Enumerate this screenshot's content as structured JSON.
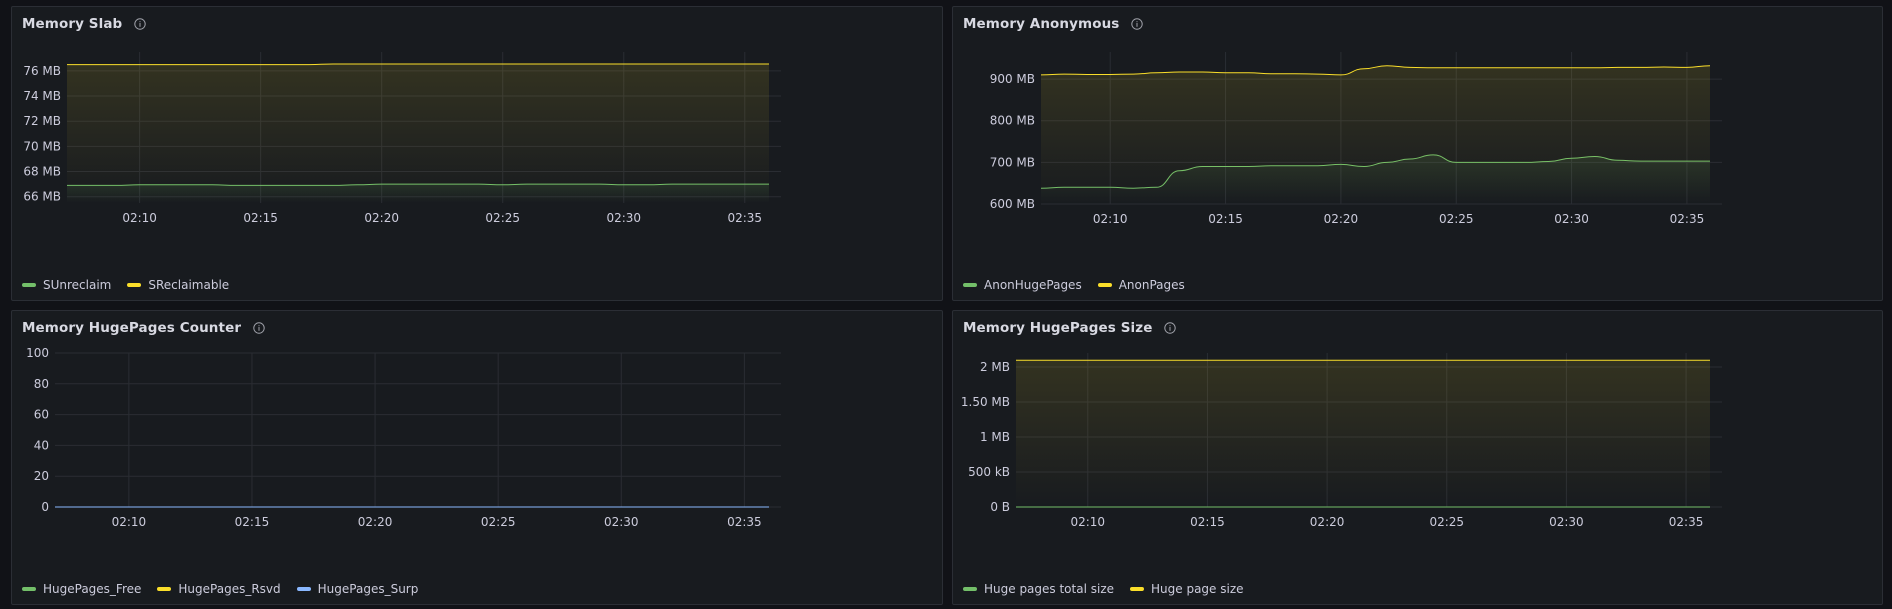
{
  "colors": {
    "green": "#73bf69",
    "yellow": "#fade2a",
    "blue": "#8ab8ff",
    "grid": "#2a2d33",
    "text": "#ccccdc"
  },
  "panels": [
    {
      "title": "Memory Slab",
      "info_icon": "info-icon",
      "legend": [
        {
          "label": "SUnreclaim",
          "color": "#73bf69"
        },
        {
          "label": "SReclaimable",
          "color": "#fade2a"
        }
      ]
    },
    {
      "title": "Memory Anonymous",
      "info_icon": "info-icon",
      "legend": [
        {
          "label": "AnonHugePages",
          "color": "#73bf69"
        },
        {
          "label": "AnonPages",
          "color": "#fade2a"
        }
      ]
    },
    {
      "title": "Memory HugePages Counter",
      "info_icon": "info-icon",
      "legend": [
        {
          "label": "HugePages_Free",
          "color": "#73bf69"
        },
        {
          "label": "HugePages_Rsvd",
          "color": "#fade2a"
        },
        {
          "label": "HugePages_Surp",
          "color": "#8ab8ff"
        }
      ]
    },
    {
      "title": "Memory HugePages Size",
      "info_icon": "info-icon",
      "legend": [
        {
          "label": "Huge pages total size",
          "color": "#73bf69"
        },
        {
          "label": "Huge page size",
          "color": "#fade2a"
        }
      ]
    }
  ],
  "chart_data": [
    {
      "type": "line",
      "title": "Memory Slab",
      "x": [
        "02:07",
        "02:08",
        "02:09",
        "02:10",
        "02:11",
        "02:12",
        "02:13",
        "02:14",
        "02:15",
        "02:16",
        "02:17",
        "02:18",
        "02:19",
        "02:20",
        "02:21",
        "02:22",
        "02:23",
        "02:24",
        "02:25",
        "02:26",
        "02:27",
        "02:28",
        "02:29",
        "02:30",
        "02:31",
        "02:32",
        "02:33",
        "02:34",
        "02:35",
        "02:36"
      ],
      "xticks": [
        "02:10",
        "02:15",
        "02:20",
        "02:25",
        "02:30",
        "02:35"
      ],
      "yticks": [
        "66 MB",
        "68 MB",
        "70 MB",
        "72 MB",
        "74 MB",
        "76 MB"
      ],
      "ylim": [
        65.5,
        77.5
      ],
      "series": [
        {
          "name": "SUnreclaim",
          "color": "#73bf69",
          "values": [
            66.9,
            66.9,
            66.9,
            66.95,
            66.95,
            66.95,
            66.95,
            66.9,
            66.9,
            66.9,
            66.9,
            66.9,
            66.95,
            67.0,
            67.0,
            67.0,
            67.0,
            67.0,
            66.95,
            67.0,
            67.0,
            67.0,
            67.0,
            66.95,
            66.95,
            67.0,
            67.0,
            67.0,
            67.0,
            67.0
          ]
        },
        {
          "name": "SReclaimable",
          "color": "#fade2a",
          "values": [
            76.5,
            76.5,
            76.5,
            76.5,
            76.5,
            76.5,
            76.5,
            76.5,
            76.5,
            76.5,
            76.5,
            76.55,
            76.55,
            76.55,
            76.55,
            76.55,
            76.55,
            76.55,
            76.55,
            76.55,
            76.55,
            76.55,
            76.55,
            76.55,
            76.55,
            76.55,
            76.55,
            76.55,
            76.55,
            76.55
          ]
        }
      ]
    },
    {
      "type": "line",
      "title": "Memory Anonymous",
      "x": [
        "02:07",
        "02:08",
        "02:09",
        "02:10",
        "02:11",
        "02:12",
        "02:13",
        "02:14",
        "02:15",
        "02:16",
        "02:17",
        "02:18",
        "02:19",
        "02:20",
        "02:21",
        "02:22",
        "02:23",
        "02:24",
        "02:25",
        "02:26",
        "02:27",
        "02:28",
        "02:29",
        "02:30",
        "02:31",
        "02:32",
        "02:33",
        "02:34",
        "02:35",
        "02:36"
      ],
      "xticks": [
        "02:10",
        "02:15",
        "02:20",
        "02:25",
        "02:30",
        "02:35"
      ],
      "yticks": [
        "600 MB",
        "700 MB",
        "800 MB",
        "900 MB"
      ],
      "ylim": [
        600,
        965
      ],
      "series": [
        {
          "name": "AnonHugePages",
          "color": "#73bf69",
          "values": [
            638,
            640,
            640,
            640,
            638,
            640,
            680,
            690,
            690,
            690,
            692,
            692,
            692,
            695,
            690,
            700,
            708,
            718,
            700,
            700,
            700,
            700,
            702,
            710,
            714,
            705,
            703,
            703,
            703,
            703
          ]
        },
        {
          "name": "AnonPages",
          "color": "#fade2a",
          "values": [
            910,
            912,
            911,
            911,
            912,
            915,
            917,
            917,
            915,
            915,
            913,
            913,
            912,
            910,
            925,
            932,
            928,
            927,
            927,
            927,
            927,
            927,
            927,
            927,
            927,
            928,
            928,
            929,
            928,
            932
          ]
        }
      ]
    },
    {
      "type": "line",
      "title": "Memory HugePages Counter",
      "x": [
        "02:07",
        "02:36"
      ],
      "xticks": [
        "02:10",
        "02:15",
        "02:20",
        "02:25",
        "02:30",
        "02:35"
      ],
      "yticks": [
        "0",
        "20",
        "40",
        "60",
        "80",
        "100"
      ],
      "ylim": [
        0,
        100
      ],
      "series": [
        {
          "name": "HugePages_Free",
          "color": "#73bf69",
          "values": [
            0,
            0
          ]
        },
        {
          "name": "HugePages_Rsvd",
          "color": "#fade2a",
          "values": [
            0,
            0
          ]
        },
        {
          "name": "HugePages_Surp",
          "color": "#8ab8ff",
          "values": [
            0,
            0
          ]
        }
      ]
    },
    {
      "type": "line",
      "title": "Memory HugePages Size",
      "x": [
        "02:07",
        "02:36"
      ],
      "xticks": [
        "02:10",
        "02:15",
        "02:20",
        "02:25",
        "02:30",
        "02:35"
      ],
      "yticks": [
        "0 B",
        "500 kB",
        "1 MB",
        "1.50 MB",
        "2 MB"
      ],
      "ylim": [
        0,
        2.2
      ],
      "series": [
        {
          "name": "Huge pages total size",
          "color": "#73bf69",
          "values": [
            0,
            0
          ]
        },
        {
          "name": "Huge page size",
          "color": "#fade2a",
          "values": [
            2.097,
            2.097
          ]
        }
      ]
    }
  ]
}
